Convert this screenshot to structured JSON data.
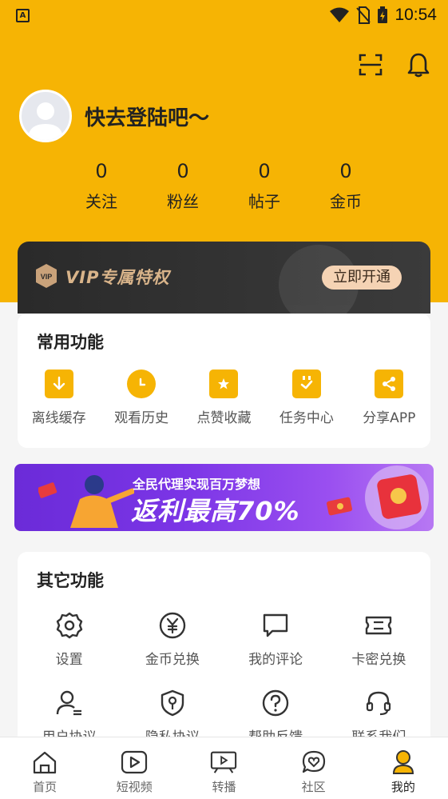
{
  "status_bar": {
    "time": "10:54",
    "app_icon": "A"
  },
  "header": {
    "icons": [
      "scan-icon",
      "bell-icon"
    ],
    "login_text": "快去登陆吧～",
    "stats": [
      {
        "value": "0",
        "label": "关注"
      },
      {
        "value": "0",
        "label": "粉丝"
      },
      {
        "value": "0",
        "label": "帖子"
      },
      {
        "value": "0",
        "label": "金币"
      }
    ]
  },
  "vip": {
    "badge": "VIP",
    "title": "VIP专属特权",
    "button": "立即开通"
  },
  "common_functions": {
    "title": "常用功能",
    "items": [
      {
        "label": "离线缓存",
        "icon": "download-icon"
      },
      {
        "label": "观看历史",
        "icon": "clock-icon"
      },
      {
        "label": "点赞收藏",
        "icon": "star-icon"
      },
      {
        "label": "任务中心",
        "icon": "task-check-icon"
      },
      {
        "label": "分享APP",
        "icon": "share-icon"
      }
    ]
  },
  "banner": {
    "subtitle": "全民代理实现百万梦想",
    "headline": "返利最高70%"
  },
  "other_functions": {
    "title": "其它功能",
    "items": [
      {
        "label": "设置",
        "icon": "gear-icon"
      },
      {
        "label": "金币兑换",
        "icon": "coin-icon"
      },
      {
        "label": "我的评论",
        "icon": "comment-icon"
      },
      {
        "label": "卡密兑换",
        "icon": "ticket-icon"
      },
      {
        "label": "用户协议",
        "icon": "user-agreement-icon"
      },
      {
        "label": "隐私协议",
        "icon": "shield-key-icon"
      },
      {
        "label": "帮助反馈",
        "icon": "help-icon"
      },
      {
        "label": "联系我们",
        "icon": "headset-icon"
      }
    ]
  },
  "tabbar": {
    "tabs": [
      {
        "label": "首页",
        "icon": "home-icon"
      },
      {
        "label": "短视频",
        "icon": "play-icon"
      },
      {
        "label": "转播",
        "icon": "tv-icon"
      },
      {
        "label": "社区",
        "icon": "heart-chat-icon"
      },
      {
        "label": "我的",
        "icon": "profile-icon"
      }
    ],
    "active": "我的"
  },
  "colors": {
    "accent": "#f6b404",
    "vip_gold": "#d9b48a"
  }
}
